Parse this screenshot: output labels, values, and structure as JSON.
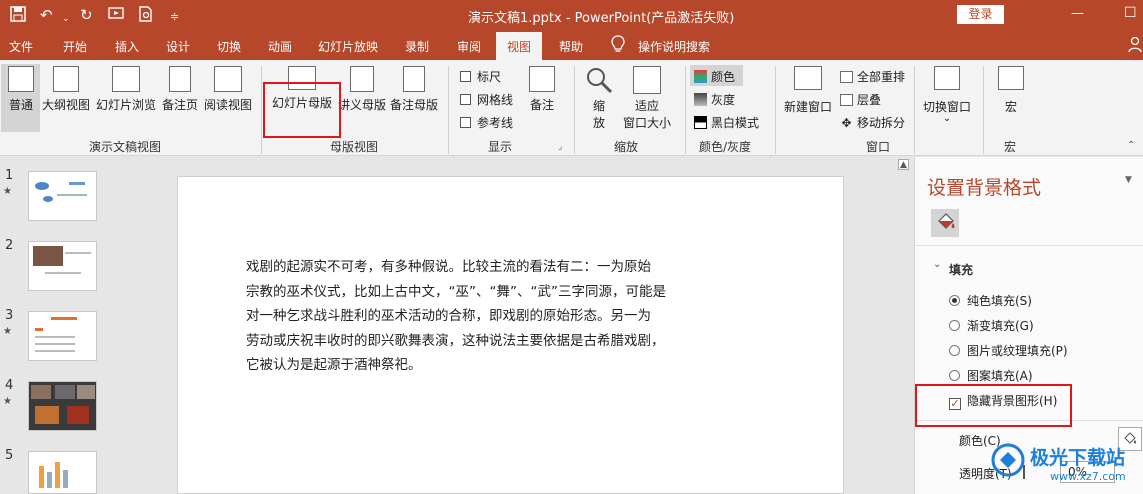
{
  "titlebar": {
    "title": "演示文稿1.pptx  -  PowerPoint(产品激活失败)",
    "login": "登录",
    "icons": [
      "save-icon",
      "undo-icon",
      "undo-dropdown-icon",
      "redo-icon",
      "start-from-beginning-icon",
      "print-preview-icon",
      "customize-qat-icon"
    ]
  },
  "window_controls": {
    "minimize": "—",
    "maximize": "☐"
  },
  "tabs": [
    "文件",
    "开始",
    "插入",
    "设计",
    "切换",
    "动画",
    "幻灯片放映",
    "录制",
    "审阅",
    "视图",
    "帮助"
  ],
  "active_tab": "视图",
  "tell_me": "操作说明搜索",
  "ribbon": {
    "presentation_views": {
      "group": "演示文稿视图",
      "buttons": [
        "普通",
        "大纲视图",
        "幻灯片浏览",
        "备注页",
        "阅读视图"
      ]
    },
    "master_views": {
      "group": "母版视图",
      "buttons": [
        "幻灯片母版",
        "讲义母版",
        "备注母版"
      ]
    },
    "show": {
      "group": "显示",
      "checkboxes": [
        "标尺",
        "网格线",
        "参考线"
      ],
      "notes": "备注"
    },
    "zoom": {
      "group": "缩放",
      "zoom_label_1": "缩",
      "zoom_label_2": "放",
      "fit_1": "适应",
      "fit_2": "窗口大小"
    },
    "color": {
      "group": "颜色/灰度",
      "items": [
        "颜色",
        "灰度",
        "黑白模式"
      ]
    },
    "window": {
      "group": "窗口",
      "new_window": "新建窗口",
      "items": [
        "全部重排",
        "层叠",
        "移动拆分"
      ]
    },
    "switch_window": {
      "label": "切换窗口",
      "arrow": "⌄"
    },
    "macros": {
      "group": "宏",
      "label": "宏"
    }
  },
  "slides": [
    {
      "num": "1",
      "star": "★"
    },
    {
      "num": "2",
      "star": ""
    },
    {
      "num": "3",
      "star": "★"
    },
    {
      "num": "4",
      "star": "★"
    },
    {
      "num": "5",
      "star": ""
    }
  ],
  "slide_text": [
    "戏剧的起源实不可考，有多种假说。比较主流的看法有二：一为原始",
    "宗教的巫术仪式，比如上古中文，“巫”、“舞”、“武”三字同源，可能是",
    "对一种乞求战斗胜利的巫术活动的合称，即戏剧的原始形态。另一为",
    "劳动或庆祝丰收时的即兴歌舞表演，这种说法主要依据是古希腊戏剧，",
    "它被认为是起源于酒神祭祀。"
  ],
  "pane": {
    "title": "设置背景格式",
    "section": "填充",
    "options": [
      {
        "label": "纯色填充(S)",
        "checked": true
      },
      {
        "label": "渐变填充(G)",
        "checked": false
      },
      {
        "label": "图片或纹理填充(P)",
        "checked": false
      },
      {
        "label": "图案填充(A)",
        "checked": false
      }
    ],
    "hide_bg": "隐藏背景图形(H)",
    "color_label": "颜色(C)",
    "transparency_label": "透明度(T)",
    "transparency_value": "0%"
  },
  "watermark": {
    "text": "极光下载站",
    "url": "www.xz7.com"
  },
  "colors": {
    "accent": "#b7472a",
    "highlight": "#e0161c"
  }
}
